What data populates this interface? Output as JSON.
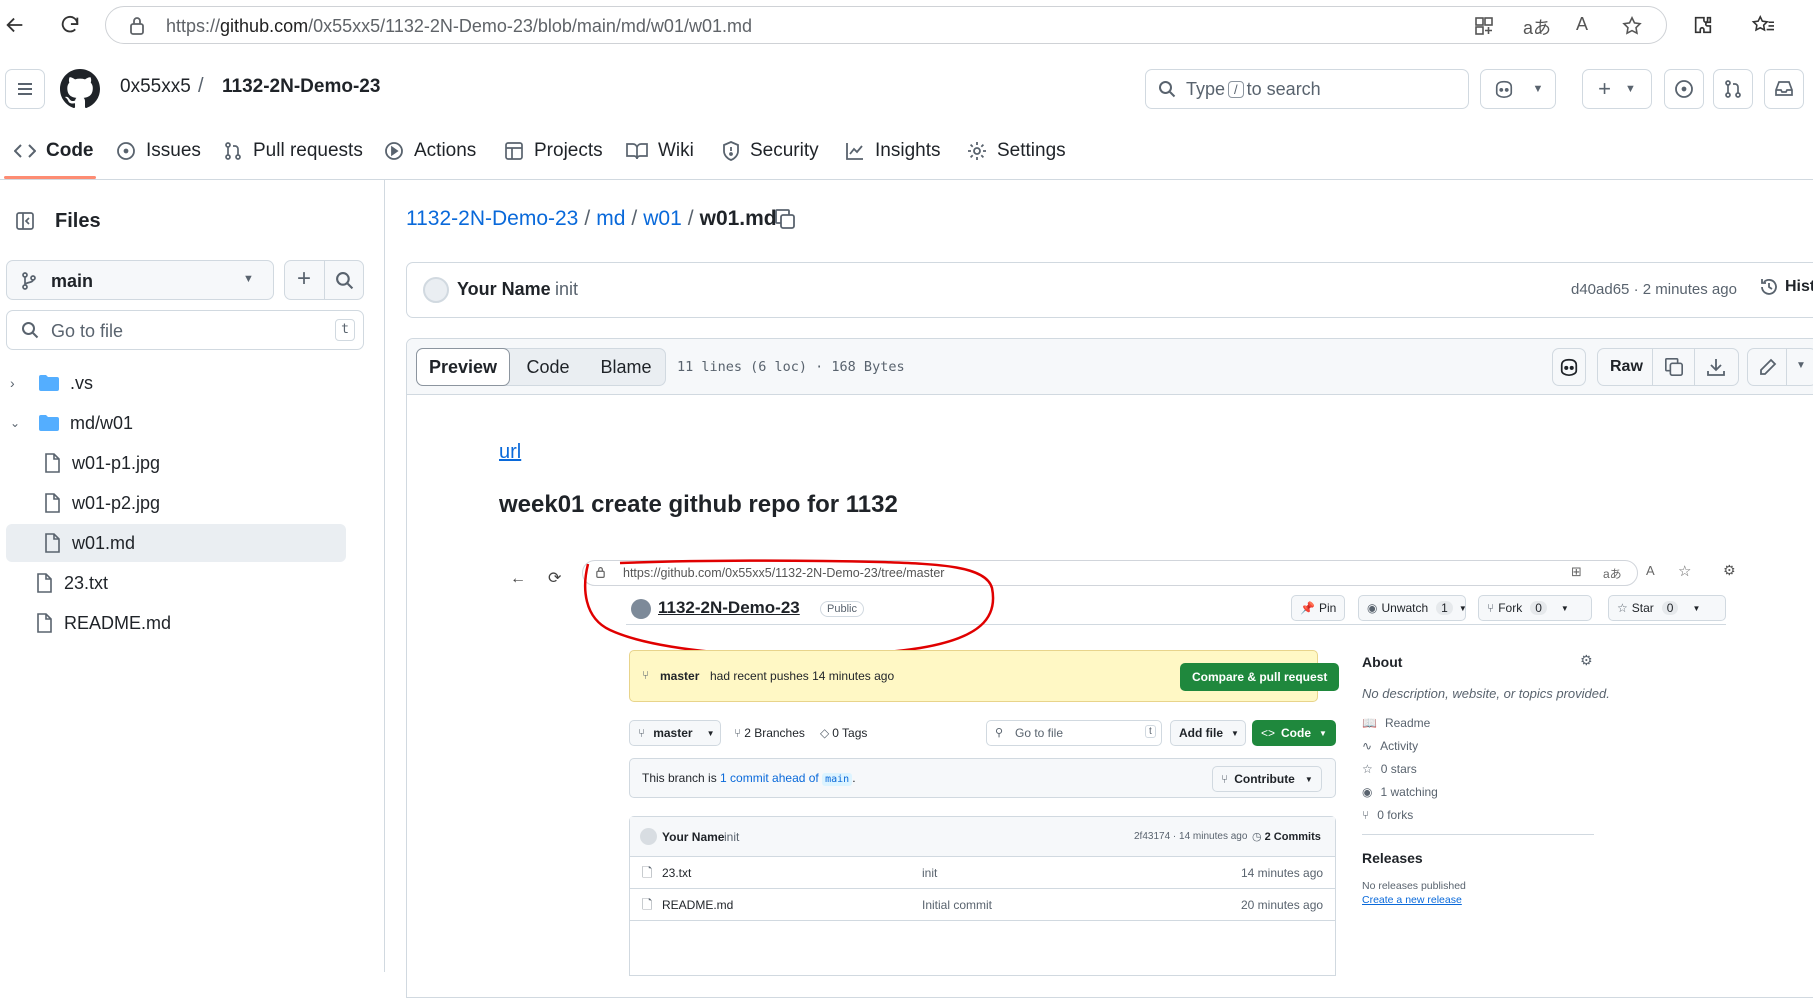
{
  "browser": {
    "url_prefix": "https://",
    "url_host": "github.com",
    "url_path": "/0x55xx5/1132-2N-Demo-23/blob/main/md/w01/w01.md"
  },
  "header": {
    "owner": "0x55xx5",
    "separator": "/",
    "repo": "1132-2N-Demo-23",
    "search_prefix": "Type",
    "search_key": "/",
    "search_suffix": "to search"
  },
  "tabs": [
    {
      "label": "Code",
      "icon": "code-icon"
    },
    {
      "label": "Issues",
      "icon": "issue-icon"
    },
    {
      "label": "Pull requests",
      "icon": "pull-request-icon"
    },
    {
      "label": "Actions",
      "icon": "play-icon"
    },
    {
      "label": "Projects",
      "icon": "table-icon"
    },
    {
      "label": "Wiki",
      "icon": "book-icon"
    },
    {
      "label": "Security",
      "icon": "shield-icon"
    },
    {
      "label": "Insights",
      "icon": "graph-icon"
    },
    {
      "label": "Settings",
      "icon": "gear-icon"
    }
  ],
  "sidebar": {
    "title": "Files",
    "branch": "main",
    "goto_placeholder": "Go to file",
    "goto_key": "t",
    "tree": [
      {
        "name": ".vs",
        "type": "folder",
        "expanded": false
      },
      {
        "name": "md/w01",
        "type": "folder",
        "expanded": true
      },
      {
        "name": "w01-p1.jpg",
        "type": "file"
      },
      {
        "name": "w01-p2.jpg",
        "type": "file"
      },
      {
        "name": "w01.md",
        "type": "file",
        "selected": true
      },
      {
        "name": "23.txt",
        "type": "file"
      },
      {
        "name": "README.md",
        "type": "file"
      }
    ]
  },
  "breadcrumb": {
    "repo": "1132-2N-Demo-23",
    "dir1": "md",
    "dir2": "w01",
    "file": "w01.md",
    "sep": "/"
  },
  "commit": {
    "author": "Your Name",
    "message": "init",
    "sha_time": "d40ad65 · 2 minutes ago",
    "history": "History"
  },
  "file": {
    "tabs": [
      "Preview",
      "Code",
      "Blame"
    ],
    "meta": "11 lines (6 loc) · 168 Bytes",
    "raw": "Raw"
  },
  "content": {
    "link": "url",
    "heading": "week01 create github repo for 1132"
  },
  "shot": {
    "url": "https://github.com/0x55xx5/1132-2N-Demo-23/tree/master",
    "repo": "1132-2N-Demo-23",
    "visibility": "Public",
    "pin": "Pin",
    "unwatch": "Unwatch",
    "unwatch_count": "1",
    "fork": "Fork",
    "fork_count": "0",
    "star": "Star",
    "star_count": "0",
    "push_branch": "master",
    "push_msg": "had recent pushes 14 minutes ago",
    "compare": "Compare & pull request",
    "branch": "master",
    "branches": "2 Branches",
    "tags": "0 Tags",
    "goto": "Go to file",
    "goto_key": "t",
    "addfile": "Add file",
    "code": "Code",
    "ahead_pre": "This branch is",
    "ahead_link": "1 commit ahead of",
    "ahead_main": "main",
    "ahead_dot": ".",
    "contribute": "Contribute",
    "author": "Your Name",
    "commit_msg": "init",
    "commit_meta": "2f43174 · 14 minutes ago",
    "commits": "2 Commits",
    "files": [
      {
        "name": "23.txt",
        "msg": "init",
        "time": "14 minutes ago"
      },
      {
        "name": "README.md",
        "msg": "Initial commit",
        "time": "20 minutes ago"
      }
    ],
    "about_title": "About",
    "about_desc": "No description, website, or topics provided.",
    "about_items": [
      {
        "label": "Readme",
        "icon": "book-icon"
      },
      {
        "label": "Activity",
        "icon": "pulse-icon"
      },
      {
        "label": "0 stars",
        "icon": "star-icon"
      },
      {
        "label": "1 watching",
        "icon": "eye-icon"
      },
      {
        "label": "0 forks",
        "icon": "fork-icon"
      }
    ],
    "releases_title": "Releases",
    "releases_none": "No releases published",
    "releases_create": "Create a new release"
  },
  "colors": {
    "accent_link": "#0969da",
    "tab_underline": "#fd8c73",
    "annotation_red": "#e00000",
    "green_button": "#1f883d",
    "banner_yellow": "#fff8c5"
  }
}
